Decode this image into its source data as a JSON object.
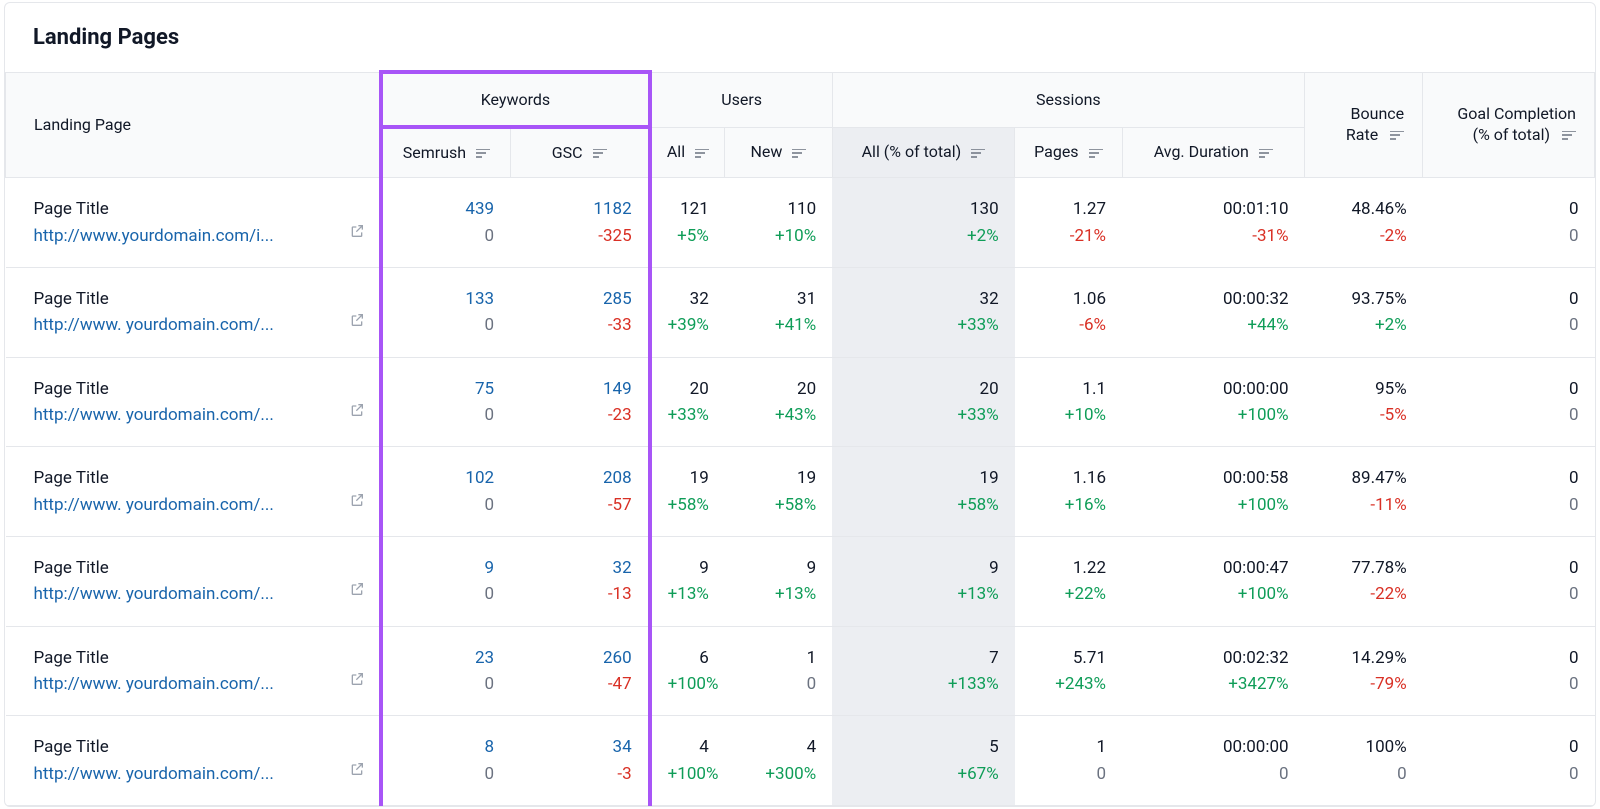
{
  "title": "Landing Pages",
  "headers": {
    "landing_page": "Landing Page",
    "keywords": "Keywords",
    "users": "Users",
    "sessions": "Sessions",
    "semrush": "Semrush",
    "gsc": "GSC",
    "all": "All",
    "new": "New",
    "sess_all": "All (% of total)",
    "pages": "Pages",
    "avg_duration": "Avg. Duration",
    "bounce_rate": "Bounce\nRate",
    "goal_completion": "Goal Completion\n(% of total)"
  },
  "rows": [
    {
      "page_title": "Page Title",
      "url": "http://www.yourdomain.com/i...",
      "semrush": "439",
      "semrush_sub": "0",
      "gsc": "1182",
      "gsc_sub": "-325",
      "users_all": "121",
      "users_all_sub": "+5%",
      "users_new": "110",
      "users_new_sub": "+10%",
      "sess_all": "130",
      "sess_all_sub": "+2%",
      "pages": "1.27",
      "pages_sub": "-21%",
      "dur": "00:01:10",
      "dur_sub": "-31%",
      "bounce": "48.46%",
      "bounce_sub": "-2%",
      "goal": "0",
      "goal_sub": "0"
    },
    {
      "page_title": "Page Title",
      "url": "http://www. yourdomain.com/...",
      "semrush": "133",
      "semrush_sub": "0",
      "gsc": "285",
      "gsc_sub": "-33",
      "users_all": "32",
      "users_all_sub": "+39%",
      "users_new": "31",
      "users_new_sub": "+41%",
      "sess_all": "32",
      "sess_all_sub": "+33%",
      "pages": "1.06",
      "pages_sub": "-6%",
      "dur": "00:00:32",
      "dur_sub": "+44%",
      "bounce": "93.75%",
      "bounce_sub": "+2%",
      "goal": "0",
      "goal_sub": "0"
    },
    {
      "page_title": "Page Title",
      "url": "http://www. yourdomain.com/...",
      "semrush": "75",
      "semrush_sub": "0",
      "gsc": "149",
      "gsc_sub": "-23",
      "users_all": "20",
      "users_all_sub": "+33%",
      "users_new": "20",
      "users_new_sub": "+43%",
      "sess_all": "20",
      "sess_all_sub": "+33%",
      "pages": "1.1",
      "pages_sub": "+10%",
      "dur": "00:00:00",
      "dur_sub": "+100%",
      "bounce": "95%",
      "bounce_sub": "-5%",
      "goal": "0",
      "goal_sub": "0"
    },
    {
      "page_title": "Page Title",
      "url": "http://www. yourdomain.com/...",
      "semrush": "102",
      "semrush_sub": "0",
      "gsc": "208",
      "gsc_sub": "-57",
      "users_all": "19",
      "users_all_sub": "+58%",
      "users_new": "19",
      "users_new_sub": "+58%",
      "sess_all": "19",
      "sess_all_sub": "+58%",
      "pages": "1.16",
      "pages_sub": "+16%",
      "dur": "00:00:58",
      "dur_sub": "+100%",
      "bounce": "89.47%",
      "bounce_sub": "-11%",
      "goal": "0",
      "goal_sub": "0"
    },
    {
      "page_title": "Page Title",
      "url": "http://www. yourdomain.com/...",
      "semrush": "9",
      "semrush_sub": "0",
      "gsc": "32",
      "gsc_sub": "-13",
      "users_all": "9",
      "users_all_sub": "+13%",
      "users_new": "9",
      "users_new_sub": "+13%",
      "sess_all": "9",
      "sess_all_sub": "+13%",
      "pages": "1.22",
      "pages_sub": "+22%",
      "dur": "00:00:47",
      "dur_sub": "+100%",
      "bounce": "77.78%",
      "bounce_sub": "-22%",
      "goal": "0",
      "goal_sub": "0"
    },
    {
      "page_title": "Page Title",
      "url": "http://www. yourdomain.com/...",
      "semrush": "23",
      "semrush_sub": "0",
      "gsc": "260",
      "gsc_sub": "-47",
      "users_all": "6",
      "users_all_sub": "+100%",
      "users_new": "1",
      "users_new_sub": "0",
      "sess_all": "7",
      "sess_all_sub": "+133%",
      "pages": "5.71",
      "pages_sub": "+243%",
      "dur": "00:02:32",
      "dur_sub": "+3427%",
      "bounce": "14.29%",
      "bounce_sub": "-79%",
      "goal": "0",
      "goal_sub": "0"
    },
    {
      "page_title": "Page Title",
      "url": "http://www. yourdomain.com/...",
      "semrush": "8",
      "semrush_sub": "0",
      "gsc": "34",
      "gsc_sub": "-3",
      "users_all": "4",
      "users_all_sub": "+100%",
      "users_new": "4",
      "users_new_sub": "+300%",
      "sess_all": "5",
      "sess_all_sub": "+67%",
      "pages": "1",
      "pages_sub": "0",
      "dur": "00:00:00",
      "dur_sub": "0",
      "bounce": "100%",
      "bounce_sub": "0",
      "goal": "0",
      "goal_sub": "0"
    }
  ]
}
